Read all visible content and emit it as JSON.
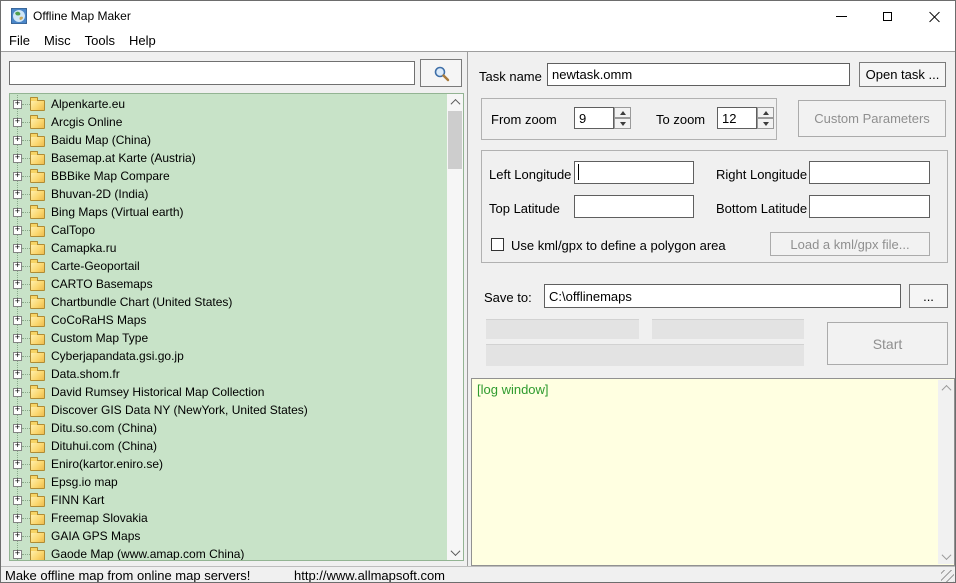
{
  "window": {
    "title": "Offline Map Maker"
  },
  "menu": {
    "items": [
      "File",
      "Misc",
      "Tools",
      "Help"
    ]
  },
  "left_panel": {
    "search": {
      "value": ""
    },
    "tree_items": [
      "Alpenkarte.eu",
      "Arcgis Online",
      "Baidu Map (China)",
      "Basemap.at Karte (Austria)",
      "BBBike Map Compare",
      "Bhuvan-2D (India)",
      "Bing Maps (Virtual earth)",
      "CalTopo",
      "Camapka.ru",
      "Carte-Geoportail",
      "CARTO Basemaps",
      "Chartbundle Chart (United States)",
      "CoCoRaHS Maps",
      "Custom Map Type",
      "Cyberjapandata.gsi.go.jp",
      "Data.shom.fr",
      "David Rumsey Historical Map Collection",
      "Discover GIS Data NY (NewYork, United States)",
      "Ditu.so.com (China)",
      "Dituhui.com (China)",
      "Eniro(kartor.eniro.se)",
      "Epsg.io map",
      "FINN Kart",
      "Freemap Slovakia",
      "GAIA GPS Maps",
      "Gaode Map (www.amap.com China)"
    ]
  },
  "right_panel": {
    "task": {
      "label": "Task name",
      "value": "newtask.omm",
      "open_button": "Open task ..."
    },
    "zoom": {
      "from_label": "From zoom",
      "from_value": "9",
      "to_label": "To zoom",
      "to_value": "12",
      "custom_params_button": "Custom Parameters"
    },
    "area": {
      "left_longitude_label": "Left Longitude",
      "right_longitude_label": "Right Longitude",
      "top_latitude_label": "Top Latitude",
      "bottom_latitude_label": "Bottom Latitude",
      "left_longitude_value": "",
      "right_longitude_value": "",
      "top_latitude_value": "",
      "bottom_latitude_value": "",
      "kml_checkbox_label": "Use kml/gpx to define a polygon area",
      "load_kml_button": "Load a kml/gpx file..."
    },
    "save": {
      "label": "Save to:",
      "path": "C:\\offlinemaps",
      "browse_button": "..."
    },
    "start_button": "Start",
    "log": {
      "text": "[log window]"
    }
  },
  "status_bar": {
    "message": "Make offline map from online map servers!",
    "url": "http://www.allmapsoft.com"
  },
  "icons": {
    "expand_glyph": "+"
  },
  "colors": {
    "tree_bg": "#c8e3c8",
    "log_bg": "#ffffe1",
    "log_text": "#2e9b2e",
    "panel_bg": "#f0f0f0"
  }
}
